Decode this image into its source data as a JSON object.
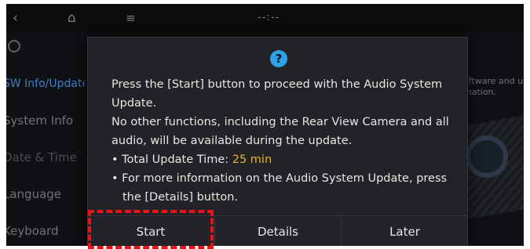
{
  "topbar": {
    "back_icon": "back-chevron-icon",
    "back_glyph": "‹",
    "home_icon": "home-icon",
    "home_glyph": "⌂",
    "menu_icon": "menu-icon",
    "menu_glyph": "≡",
    "center_indicator": "--:--"
  },
  "sidebar": {
    "search_icon": "search-icon",
    "items": [
      {
        "label": "SW Info/Update"
      },
      {
        "label": "System Info"
      },
      {
        "label": "Date & Time"
      },
      {
        "label": "Language"
      },
      {
        "label": "Keyboard"
      }
    ]
  },
  "background": {
    "description_line1": "oftware and u",
    "description_line2": "mation."
  },
  "dialog": {
    "icon": "help-icon",
    "icon_glyph": "?",
    "message_line1": "Press the [Start] button to proceed with the Audio System Update.",
    "message_line2": "No other functions, including the Rear View Camera and all audio, will be available during the update.",
    "total_time_label": "• Total Update Time: ",
    "total_time_value": "25 min",
    "more_info": "• For more information on the Audio System Update, press the [Details] button.",
    "buttons": {
      "start": "Start",
      "details": "Details",
      "later": "Later"
    }
  },
  "colors": {
    "accent_blue": "#3f7fc6",
    "highlight_yellow": "#e5b53a",
    "help_icon_blue": "#2da2e6",
    "annotation_red": "#e8141b"
  }
}
